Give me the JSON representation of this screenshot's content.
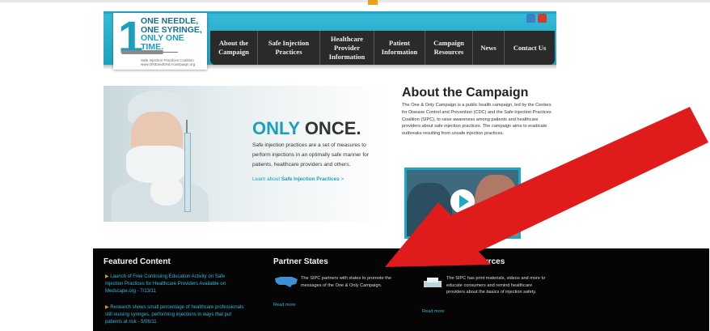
{
  "logo": {
    "numeral": "1",
    "line1": "ONE NEEDLE,",
    "line2": "ONE SYRINGE,",
    "line3": "ONLY ONE TIME.",
    "sub1": "Safe Injection Practices Coalition",
    "sub2": "www.ONEandONLYcampaign.org"
  },
  "nav": [
    {
      "label": "About the\nCampaign"
    },
    {
      "label": "Safe Injection\nPractices"
    },
    {
      "label": "Healthcare\nProvider\nInformation"
    },
    {
      "label": "Patient\nInformation"
    },
    {
      "label": "Campaign\nResources"
    },
    {
      "label": "News"
    },
    {
      "label": "Contact Us"
    }
  ],
  "social_icons": [
    "twitter-icon",
    "youtube-icon"
  ],
  "hero": {
    "title_accent": "ONLY",
    "title_rest": " ONCE.",
    "text": "Safe injection practices are a set of measures to perform injections in an optimally safe manner for patients, healthcare providers and others.",
    "link_prefix": "Learn about ",
    "link_strong": "Safe Injection Practices",
    "link_suffix": " >"
  },
  "about": {
    "heading": "About the Campaign",
    "text": "The One & Only Campaign is a public health campaign, led by the Centers for Disease Control and Prevention (CDC) and the Safe Injection Practices Coalition (SIPC), to raise awareness among patients and healthcare providers about safe injection practices. The campaign aims to eradicate outbreaks resulting from unsafe injection practices."
  },
  "footer": {
    "featured": {
      "title": "Featured Content",
      "items": [
        "Launch of Free Continuing Education Activity on Safe Injection Practices for Healthcare Providers Available on Medscape.org - 7/13/11",
        "Research shows small percentage of healthcare professionals still reusing syringes, performing injections in ways that put patients at risk - 5/06/11"
      ]
    },
    "partner": {
      "title": "Partner States",
      "text": "The SIPC partners with states to promote the messages of the One & Only Campaign.",
      "link": "Read more"
    },
    "resources": {
      "title": "Campaign Resources",
      "text": "The SIPC has print materials, videos and more to educate consumers and remind healthcare providers about the basics of injection safety.",
      "link": "Read more"
    }
  },
  "colors": {
    "accent": "#1b9fbe",
    "footer_bg": "#050505",
    "arrow": "#e01b1b"
  }
}
